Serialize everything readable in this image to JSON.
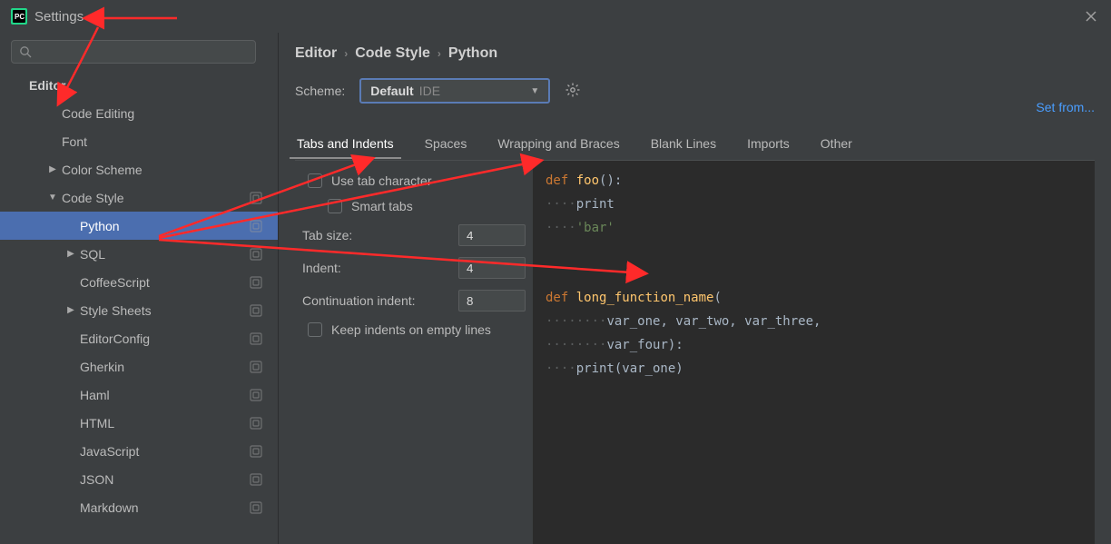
{
  "window": {
    "title": "Settings"
  },
  "breadcrumb": [
    "Editor",
    "Code Style",
    "Python"
  ],
  "scheme": {
    "label": "Scheme:",
    "value": "Default",
    "tag": "IDE"
  },
  "set_from_label": "Set from...",
  "tabs": [
    {
      "label": "Tabs and Indents",
      "active": true
    },
    {
      "label": "Spaces",
      "active": false
    },
    {
      "label": "Wrapping and Braces",
      "active": false
    },
    {
      "label": "Blank Lines",
      "active": false
    },
    {
      "label": "Imports",
      "active": false
    },
    {
      "label": "Other",
      "active": false
    }
  ],
  "indent_settings": {
    "use_tab_character": {
      "label": "Use tab character",
      "checked": false
    },
    "smart_tabs": {
      "label": "Smart tabs",
      "checked": false
    },
    "tab_size": {
      "label": "Tab size:",
      "value": "4"
    },
    "indent": {
      "label": "Indent:",
      "value": "4"
    },
    "continuation_indent": {
      "label": "Continuation indent:",
      "value": "8"
    },
    "keep_indents_empty": {
      "label": "Keep indents on empty lines",
      "checked": false
    }
  },
  "tree": {
    "root": "Editor",
    "items": [
      {
        "label": "Code Editing",
        "indent": 2
      },
      {
        "label": "Font",
        "indent": 2
      },
      {
        "label": "Color Scheme",
        "indent": 2,
        "arrow": "right"
      },
      {
        "label": "Code Style",
        "indent": 2,
        "arrow": "down",
        "badge": true
      },
      {
        "label": "Python",
        "indent": 3,
        "selected": true,
        "badge": true
      },
      {
        "label": "SQL",
        "indent": 3,
        "arrow": "right",
        "badge": true
      },
      {
        "label": "CoffeeScript",
        "indent": 3,
        "badge": true
      },
      {
        "label": "Style Sheets",
        "indent": 3,
        "arrow": "right",
        "badge": true
      },
      {
        "label": "EditorConfig",
        "indent": 3,
        "badge": true
      },
      {
        "label": "Gherkin",
        "indent": 3,
        "badge": true
      },
      {
        "label": "Haml",
        "indent": 3,
        "badge": true
      },
      {
        "label": "HTML",
        "indent": 3,
        "badge": true
      },
      {
        "label": "JavaScript",
        "indent": 3,
        "badge": true
      },
      {
        "label": "JSON",
        "indent": 3,
        "badge": true
      },
      {
        "label": "Markdown",
        "indent": 3,
        "badge": true
      }
    ]
  },
  "preview": {
    "line1": {
      "kw": "def",
      "fn": " foo",
      "rest": "():"
    },
    "line2": {
      "ws": "····",
      "text": "print"
    },
    "line3": {
      "ws": "····",
      "str": "'bar'"
    },
    "line5": {
      "kw": "def",
      "fn": " long_function_name",
      "rest": "("
    },
    "line6": {
      "ws": "········",
      "text": "var_one, var_two, var_three,"
    },
    "line7": {
      "ws": "········",
      "text": "var_four):"
    },
    "line8": {
      "ws": "····",
      "text": "print(var_one)"
    }
  }
}
